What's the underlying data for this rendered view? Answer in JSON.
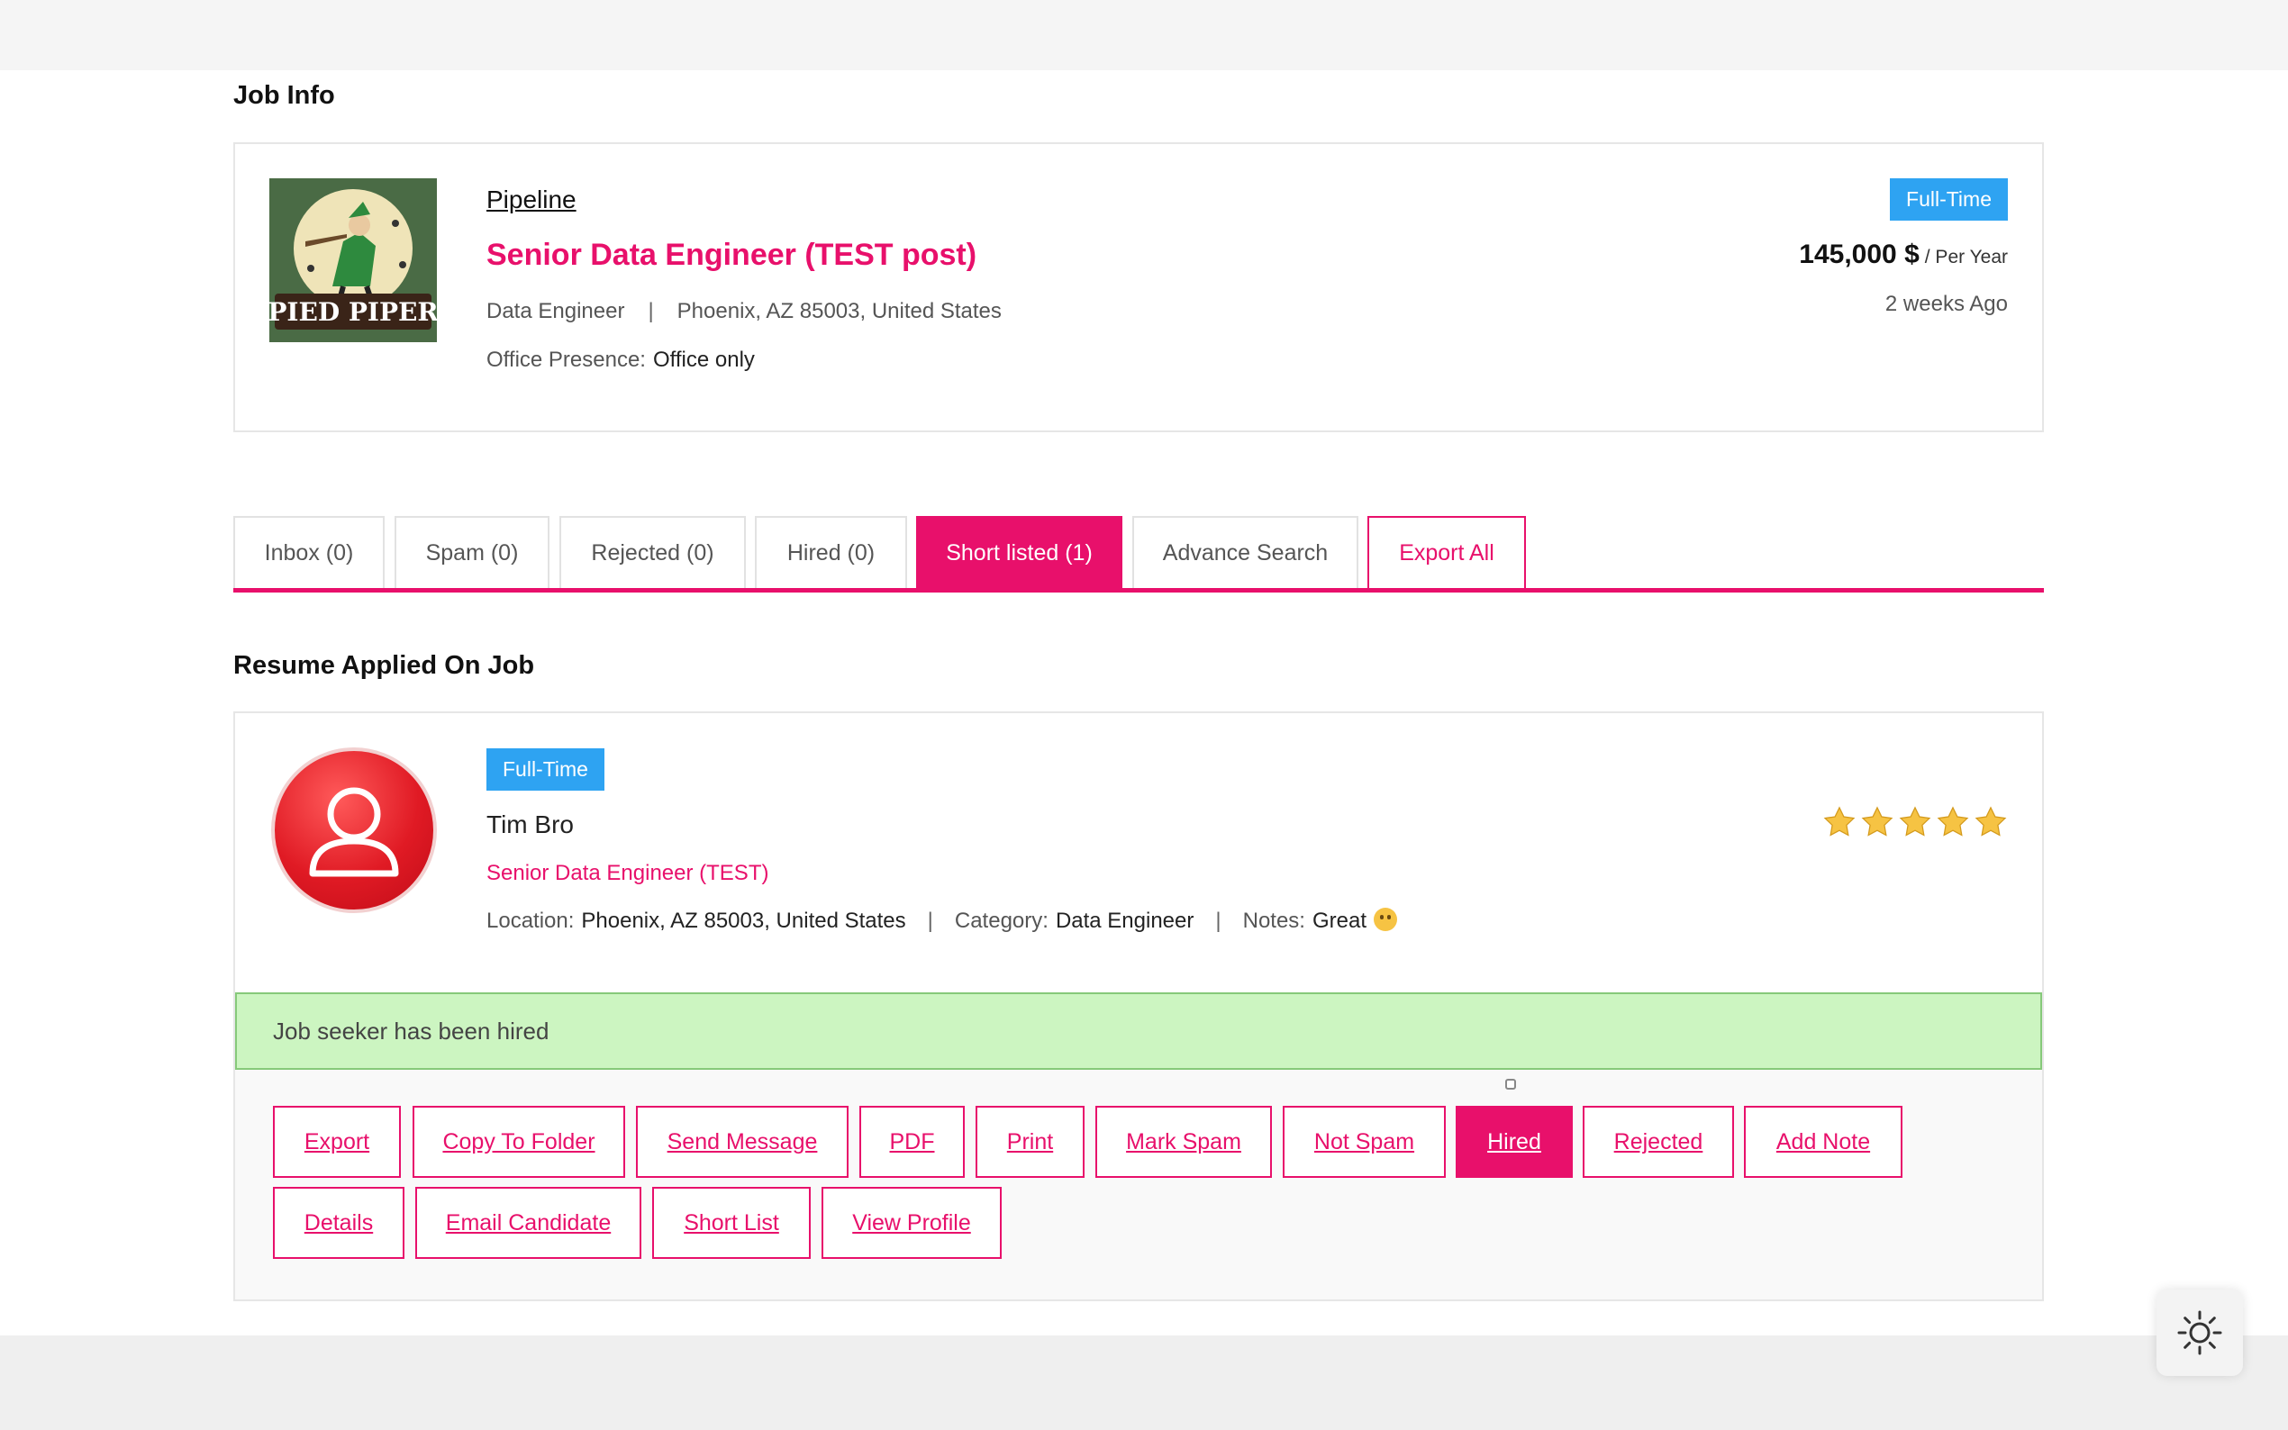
{
  "job_info": {
    "section_title": "Job Info",
    "company_logo": {
      "icon": "pied-piper-logo",
      "text": "PIED PIPER"
    },
    "company_link": "Pipeline",
    "title": "Senior Data Engineer (TEST post)",
    "category": "Data Engineer",
    "location": "Phoenix, AZ 85003, United States",
    "office_presence_label": "Office Presence:",
    "office_presence_value": "Office only",
    "job_type_badge": "Full-Time",
    "salary": "145,000 $",
    "salary_period": "/ Per Year",
    "posted": "2 weeks Ago"
  },
  "tabs": [
    {
      "label": "Inbox (0)",
      "active": false
    },
    {
      "label": "Spam (0)",
      "active": false
    },
    {
      "label": "Rejected (0)",
      "active": false
    },
    {
      "label": "Hired (0)",
      "active": false
    },
    {
      "label": "Short listed (1)",
      "active": true
    },
    {
      "label": "Advance Search",
      "active": false
    },
    {
      "label": "Export All",
      "active": false
    }
  ],
  "resume": {
    "section_title": "Resume Applied On Job",
    "job_type_badge": "Full-Time",
    "candidate_name": "Tim Bro",
    "applied_role": "Senior Data Engineer (TEST)",
    "location_label": "Location:",
    "location_value": "Phoenix, AZ 85003, United States",
    "category_label": "Category:",
    "category_value": "Data Engineer",
    "notes_label": "Notes:",
    "notes_value": "Great",
    "notes_emoji": "smiling-face-icon",
    "rating": 5,
    "rating_max": 5,
    "status_message": "Job seeker has been hired"
  },
  "actions": [
    {
      "label": "Export",
      "active": false
    },
    {
      "label": "Copy To Folder",
      "active": false
    },
    {
      "label": "Send Message",
      "active": false
    },
    {
      "label": "PDF",
      "active": false
    },
    {
      "label": "Print",
      "active": false
    },
    {
      "label": "Mark Spam",
      "active": false
    },
    {
      "label": "Not Spam",
      "active": false
    },
    {
      "label": "Hired",
      "active": true
    },
    {
      "label": "Rejected",
      "active": false
    },
    {
      "label": "Add Note",
      "active": false
    },
    {
      "label": "Details",
      "active": false
    },
    {
      "label": "Email Candidate",
      "active": false
    },
    {
      "label": "Short List",
      "active": false
    },
    {
      "label": "View Profile",
      "active": false
    }
  ],
  "colors": {
    "accent": "#e8106b",
    "badge_blue": "#2ea3f2",
    "success_bg": "#ccf5c1",
    "star": "#f6c343"
  },
  "theme_toggle_icon": "sun-icon"
}
